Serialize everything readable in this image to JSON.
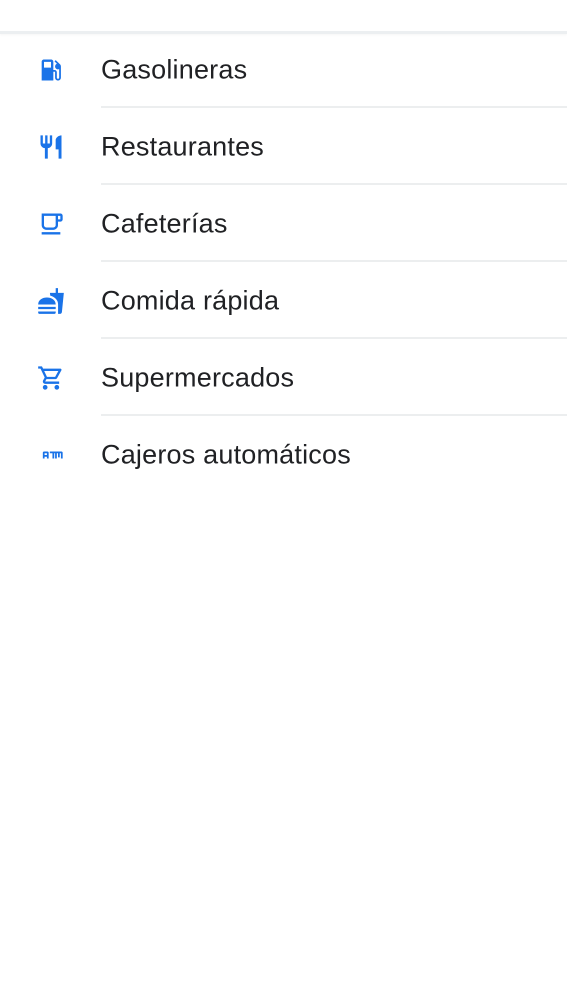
{
  "categories": [
    {
      "label": "Gasolineras",
      "icon": "gas-station-icon"
    },
    {
      "label": "Restaurantes",
      "icon": "restaurant-icon"
    },
    {
      "label": "Cafeterías",
      "icon": "coffee-icon"
    },
    {
      "label": "Comida rápida",
      "icon": "fast-food-icon"
    },
    {
      "label": "Supermercados",
      "icon": "shopping-cart-icon"
    },
    {
      "label": "Cajeros automáticos",
      "icon": "atm-icon"
    }
  ],
  "colors": {
    "accent": "#1a73e8",
    "text": "#202124",
    "divider": "#eceeef"
  }
}
